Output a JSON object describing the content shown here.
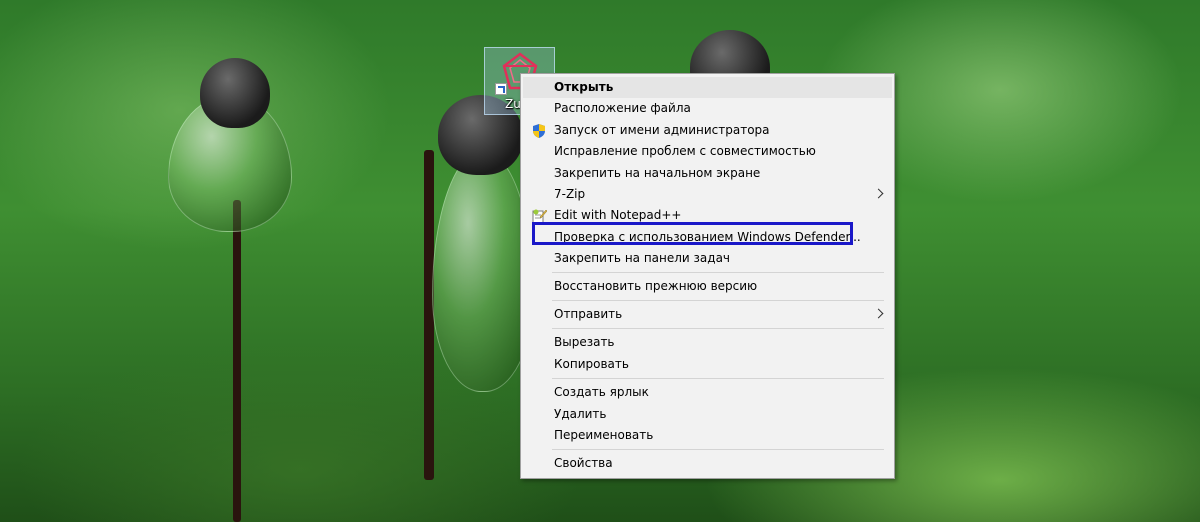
{
  "desktop": {
    "icon_label": "Zu",
    "icon_name": "zuma-app-icon"
  },
  "context_menu": {
    "items": [
      {
        "label": "Открыть",
        "bold": true,
        "hover": true
      },
      {
        "label": "Расположение файла"
      },
      {
        "label": "Запуск от имени администратора",
        "icon": "uac-shield-icon"
      },
      {
        "label": "Исправление проблем с совместимостью"
      },
      {
        "label": "Закрепить на начальном экране"
      },
      {
        "label": "7-Zip",
        "submenu": true
      },
      {
        "label": "Edit with Notepad++",
        "icon": "notepad-plus-plus-icon"
      },
      {
        "label": "Проверка с использованием Windows Defender...",
        "highlighted": true
      },
      {
        "label": "Закрепить на панели задач"
      },
      {
        "label": "Восстановить прежнюю версию"
      },
      {
        "label": "Отправить",
        "submenu": true
      },
      {
        "label": "Вырезать"
      },
      {
        "label": "Копировать"
      },
      {
        "label": "Создать ярлык"
      },
      {
        "label": "Удалить"
      },
      {
        "label": "Переименовать"
      },
      {
        "label": "Свойства"
      }
    ]
  },
  "colors": {
    "highlight_box": "#1a18c8",
    "menu_background": "#f2f2f2",
    "menu_hover": "#e5e5e5"
  }
}
